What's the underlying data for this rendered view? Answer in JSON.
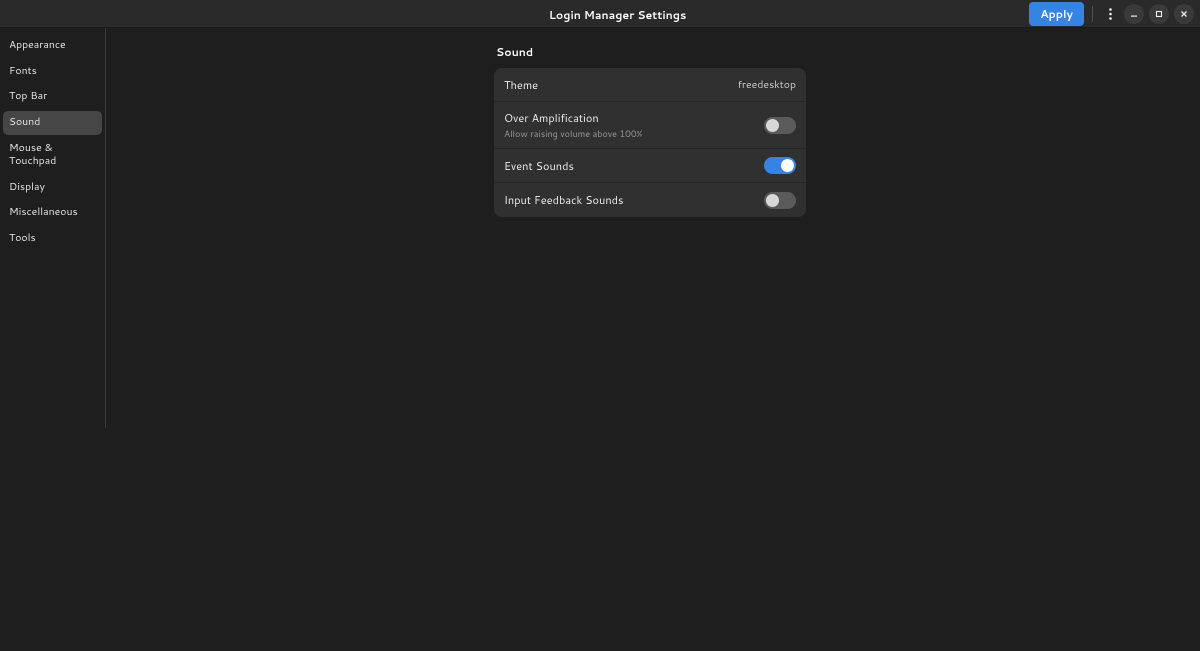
{
  "header": {
    "title": "Login Manager Settings",
    "apply_label": "Apply"
  },
  "sidebar": {
    "items": [
      {
        "label": "Appearance",
        "active": false
      },
      {
        "label": "Fonts",
        "active": false
      },
      {
        "label": "Top Bar",
        "active": false
      },
      {
        "label": "Sound",
        "active": true
      },
      {
        "label": "Mouse & Touchpad",
        "active": false
      },
      {
        "label": "Display",
        "active": false
      },
      {
        "label": "Miscellaneous",
        "active": false
      },
      {
        "label": "Tools",
        "active": false
      }
    ]
  },
  "main": {
    "section_title": "Sound",
    "rows": {
      "theme": {
        "label": "Theme",
        "value": "freedesktop"
      },
      "over_amp": {
        "label": "Over Amplification",
        "subtitle": "Allow raising volume above 100%",
        "enabled": false
      },
      "event_sounds": {
        "label": "Event Sounds",
        "enabled": true
      },
      "input_feedback": {
        "label": "Input Feedback Sounds",
        "enabled": false
      }
    }
  }
}
